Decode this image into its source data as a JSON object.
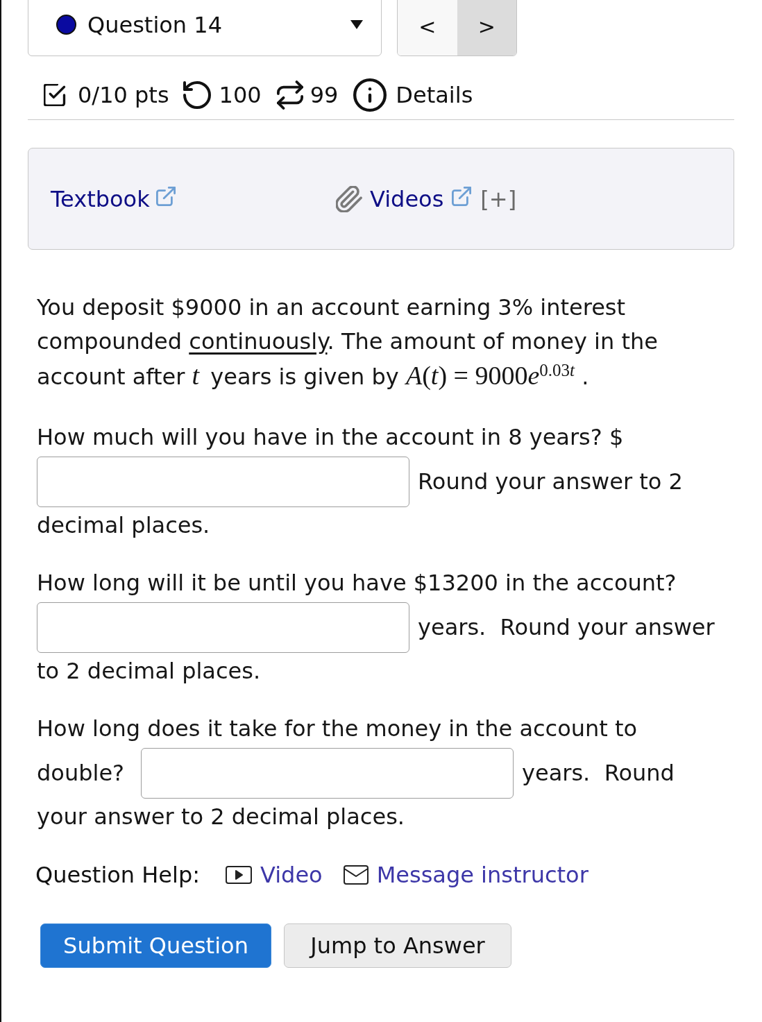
{
  "question_select": {
    "label": "Question 14"
  },
  "nav_buttons": [
    {
      "label": "<",
      "hovered": false
    },
    {
      "label": ">",
      "hovered": true
    }
  ],
  "stats": [
    {
      "kind": "score",
      "text": "0/10 pts"
    },
    {
      "kind": "retries",
      "text": "100"
    },
    {
      "kind": "attempts",
      "text": "99"
    },
    {
      "kind": "details",
      "text": "Details"
    }
  ],
  "resources": [
    {
      "kind": "textbook",
      "label": "Textbook"
    },
    {
      "kind": "videos",
      "label": "Videos",
      "expander": "[+]"
    }
  ],
  "question": {
    "intro": [
      {
        "kind": "text",
        "text": "You deposit $9000 in an account earning 3% interest compounded "
      },
      {
        "kind": "term",
        "text": "continuously"
      },
      {
        "kind": "text",
        "text": ". The amount of money in the account after "
      },
      {
        "kind": "var",
        "text": "t"
      },
      {
        "kind": "text",
        "text": " years is given by "
      },
      {
        "kind": "formula",
        "text": "A(t) = 9000e",
        "sup": "0.03t"
      },
      {
        "kind": "text",
        "text": " ."
      }
    ],
    "parts": [
      {
        "lines": [
          [
            {
              "kind": "text",
              "text": "How much will you have in the account in 8 years? $"
            }
          ],
          [
            {
              "kind": "input"
            },
            {
              "kind": "text",
              "text": "Round your answer to 2"
            }
          ],
          [
            {
              "kind": "text",
              "text": "decimal places."
            }
          ]
        ]
      },
      {
        "lines": [
          [
            {
              "kind": "text",
              "text": "How long will it be until you have $13200 in the account?"
            }
          ],
          [
            {
              "kind": "input"
            },
            {
              "kind": "text",
              "text": "years.  Round your answer"
            }
          ],
          [
            {
              "kind": "text",
              "text": "to 2 decimal places."
            }
          ]
        ]
      },
      {
        "lines": [
          [
            {
              "kind": "text",
              "text": "How long does it take for the money in the account to"
            }
          ],
          [
            {
              "kind": "text",
              "text": "double?"
            },
            {
              "kind": "input"
            },
            {
              "kind": "text",
              "text": "years.  Round"
            }
          ],
          [
            {
              "kind": "text",
              "text": "your answer to 2 decimal places."
            }
          ]
        ]
      }
    ]
  },
  "help": {
    "label": "Question Help:",
    "links": [
      {
        "kind": "video",
        "label": "Video"
      },
      {
        "kind": "message",
        "label": "Message instructor"
      }
    ]
  },
  "buttons": [
    {
      "kind": "primary",
      "label": "Submit Question"
    },
    {
      "kind": "secondary",
      "label": "Jump to Answer"
    }
  ]
}
